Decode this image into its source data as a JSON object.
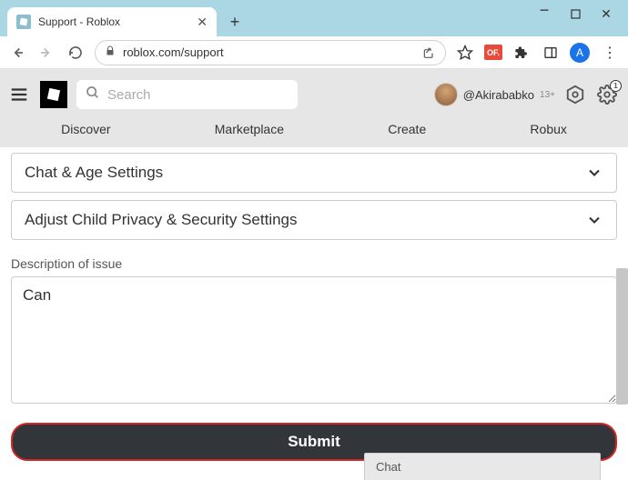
{
  "browser": {
    "tab_title": "Support - Roblox",
    "url": "roblox.com/support",
    "profile_initial": "A",
    "extension_badge": "OF."
  },
  "header": {
    "search_placeholder": "Search",
    "username": "@Akirababko",
    "age_badge": "13+",
    "settings_count": "1",
    "nav": {
      "discover": "Discover",
      "marketplace": "Marketplace",
      "create": "Create",
      "robux": "Robux"
    }
  },
  "form": {
    "accordion1": "Chat & Age Settings",
    "accordion2": "Adjust Child Privacy & Security Settings",
    "description_label": "Description of issue",
    "description_value": "Can",
    "submit_label": "Submit"
  },
  "chat": {
    "label": "Chat"
  }
}
